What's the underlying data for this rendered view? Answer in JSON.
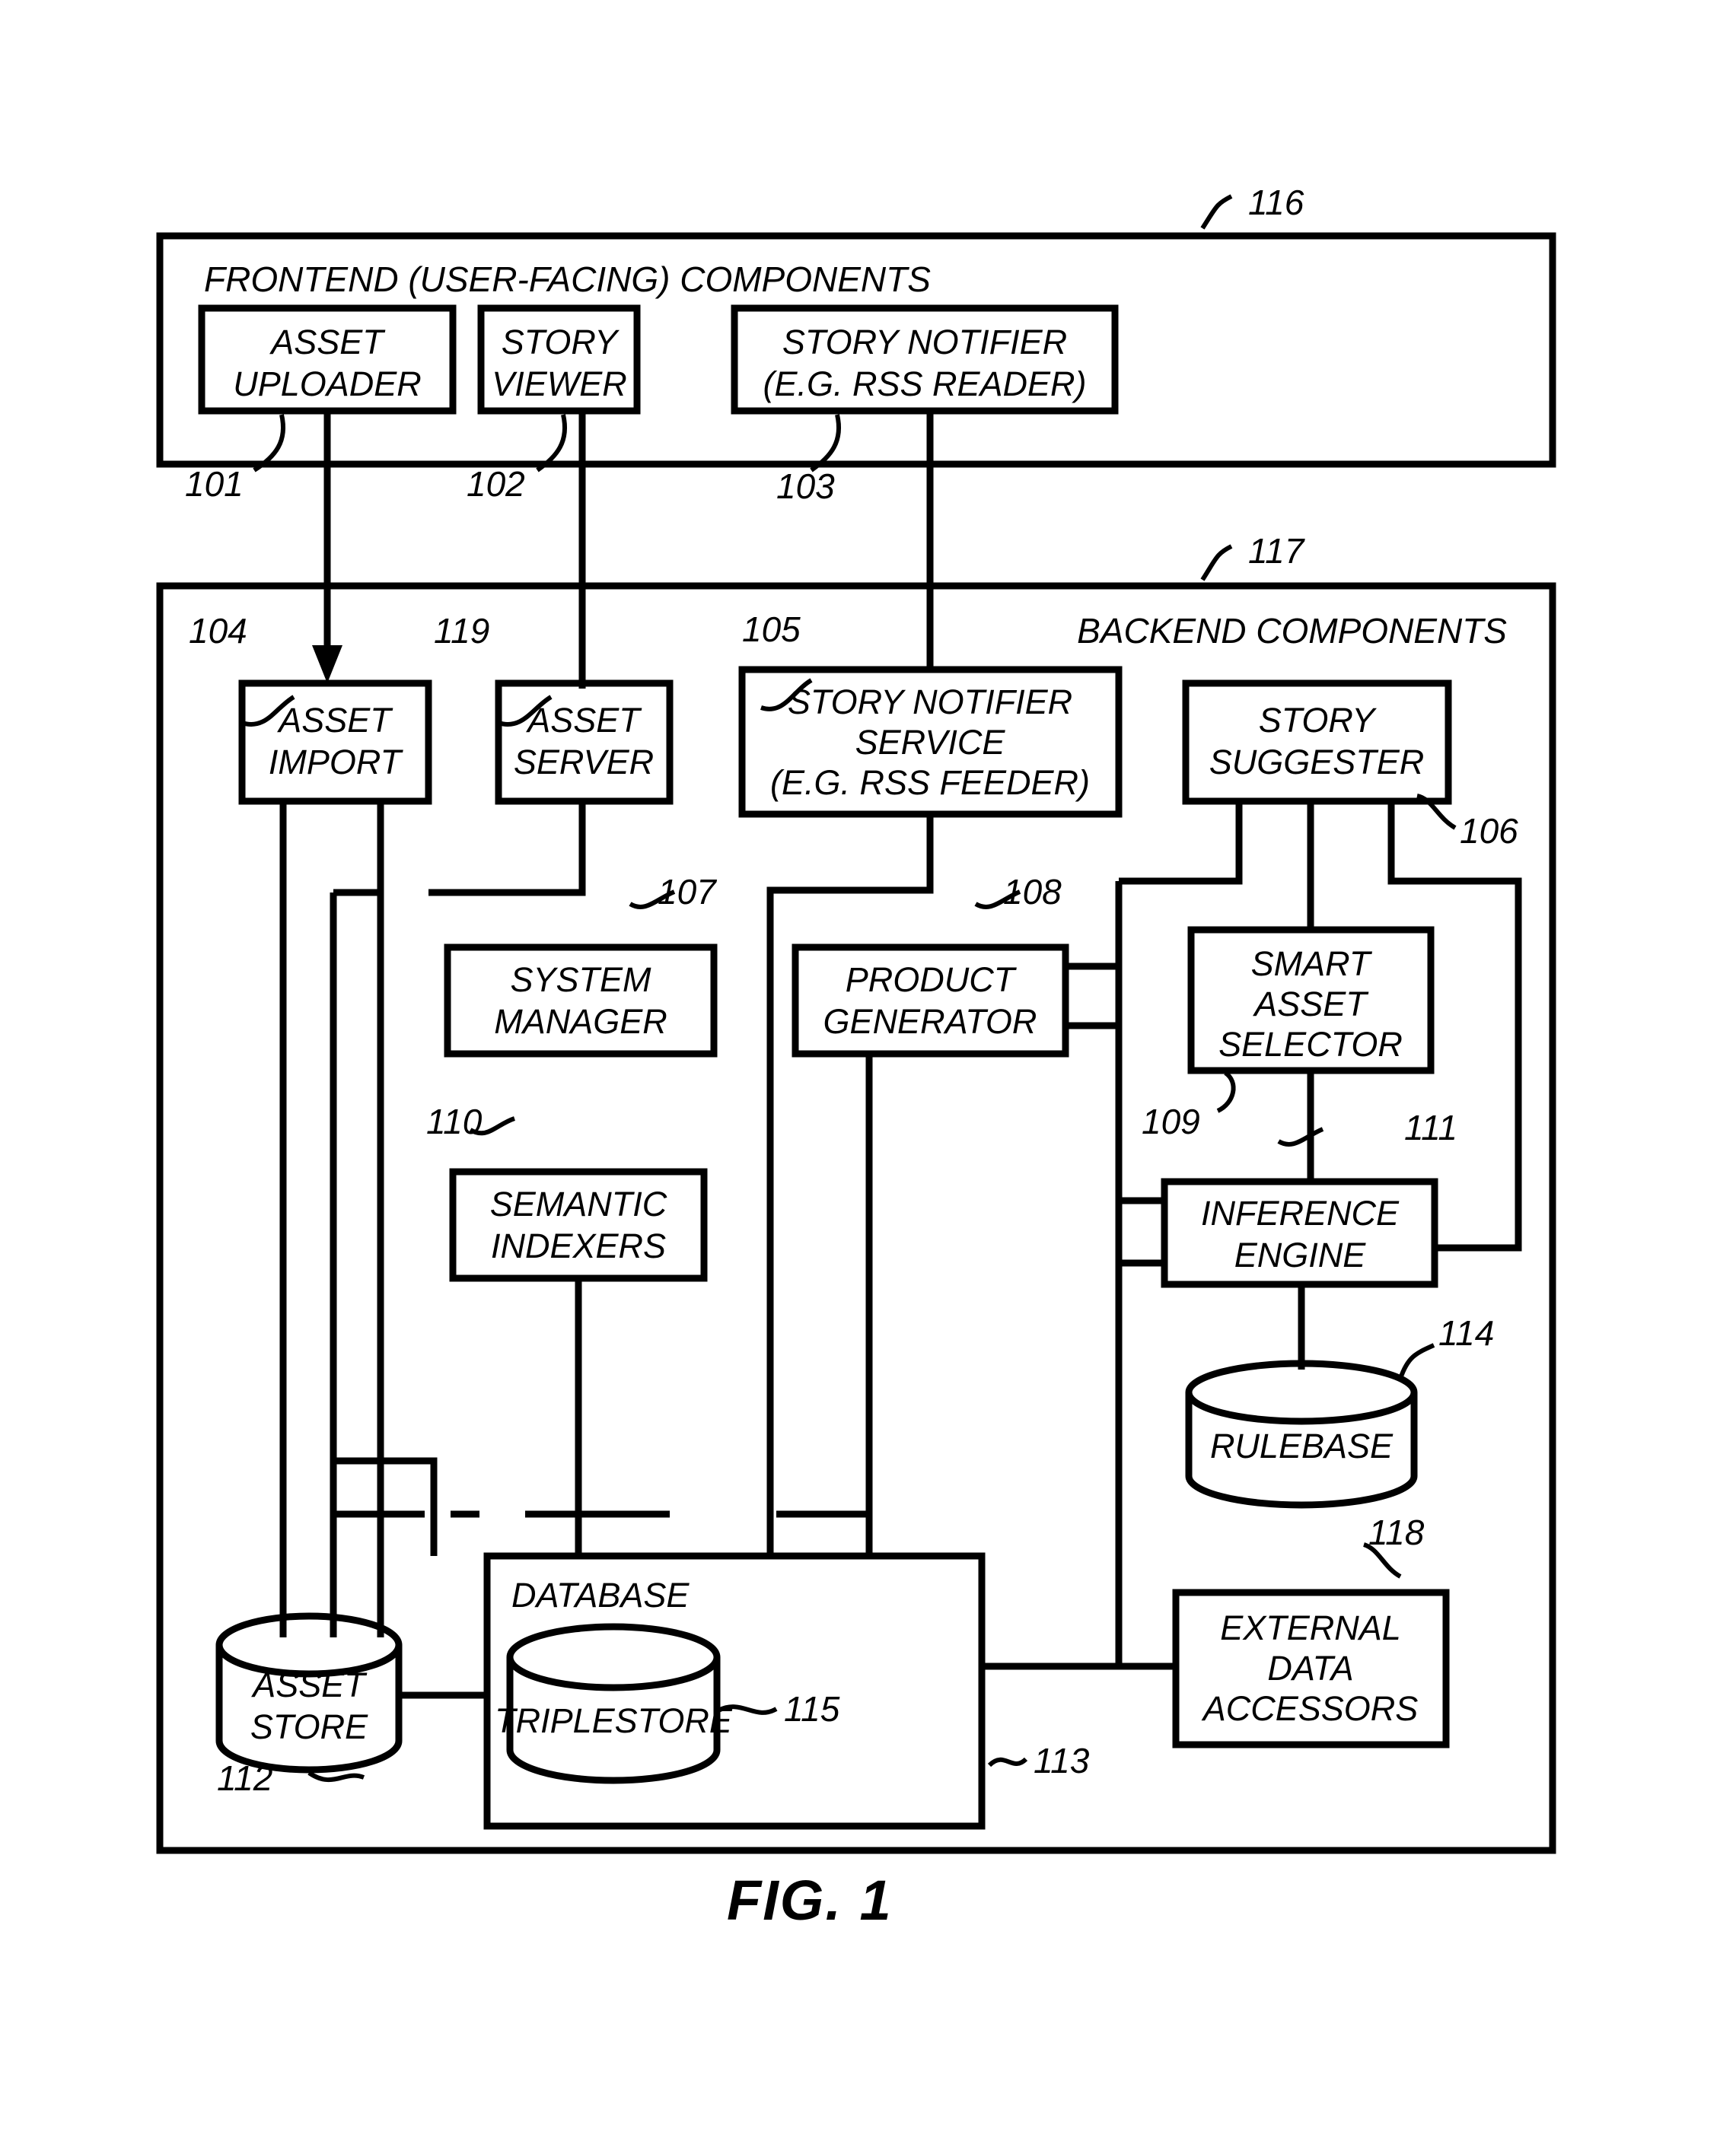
{
  "figure": {
    "caption": "FIG. 1",
    "type": "patent-block-diagram"
  },
  "frontend_panel": {
    "title": "FRONTEND (USER-FACING) COMPONENTS",
    "ref": "116",
    "boxes": [
      {
        "ref": "101",
        "lines": [
          "ASSET",
          "UPLOADER"
        ]
      },
      {
        "ref": "102",
        "lines": [
          "STORY",
          "VIEWER"
        ]
      },
      {
        "ref": "103",
        "lines": [
          "STORY NOTIFIER",
          "(E.G. RSS READER)"
        ]
      }
    ]
  },
  "backend_panel": {
    "title": "BACKEND COMPONENTS",
    "ref": "117",
    "boxes": [
      {
        "ref": "104",
        "lines": [
          "ASSET",
          "IMPORT"
        ]
      },
      {
        "ref": "119",
        "lines": [
          "ASSET",
          "SERVER"
        ]
      },
      {
        "ref": "105",
        "lines": [
          "STORY NOTIFIER",
          "SERVICE",
          "(E.G. RSS FEEDER)"
        ]
      },
      {
        "ref": "106",
        "lines": [
          "STORY",
          "SUGGESTER"
        ]
      },
      {
        "ref": "107",
        "lines": [
          "SYSTEM",
          "MANAGER"
        ]
      },
      {
        "ref": "108",
        "lines": [
          "PRODUCT",
          "GENERATOR"
        ]
      },
      {
        "ref": "109",
        "lines": [
          "SMART",
          "ASSET",
          "SELECTOR"
        ]
      },
      {
        "ref": "110",
        "lines": [
          "SEMANTIC",
          "INDEXERS"
        ]
      },
      {
        "ref": "111",
        "lines": [
          "INFERENCE",
          "ENGINE"
        ]
      },
      {
        "ref": "118",
        "lines": [
          "EXTERNAL",
          "DATA",
          "ACCESSORS"
        ]
      }
    ],
    "cylinders": [
      {
        "ref": "112",
        "lines": [
          "ASSET",
          "STORE"
        ]
      },
      {
        "ref": "114",
        "lines": [
          "RULEBASE"
        ]
      },
      {
        "ref": "115",
        "lines": [
          "TRIPLESTORE"
        ]
      }
    ],
    "database": {
      "ref": "113",
      "title": "DATABASE"
    }
  },
  "reference_numerals": [
    "101",
    "102",
    "103",
    "104",
    "105",
    "106",
    "107",
    "108",
    "109",
    "110",
    "111",
    "112",
    "113",
    "114",
    "115",
    "116",
    "117",
    "118",
    "119"
  ],
  "colors": {
    "stroke": "#000000",
    "background": "#ffffff"
  }
}
